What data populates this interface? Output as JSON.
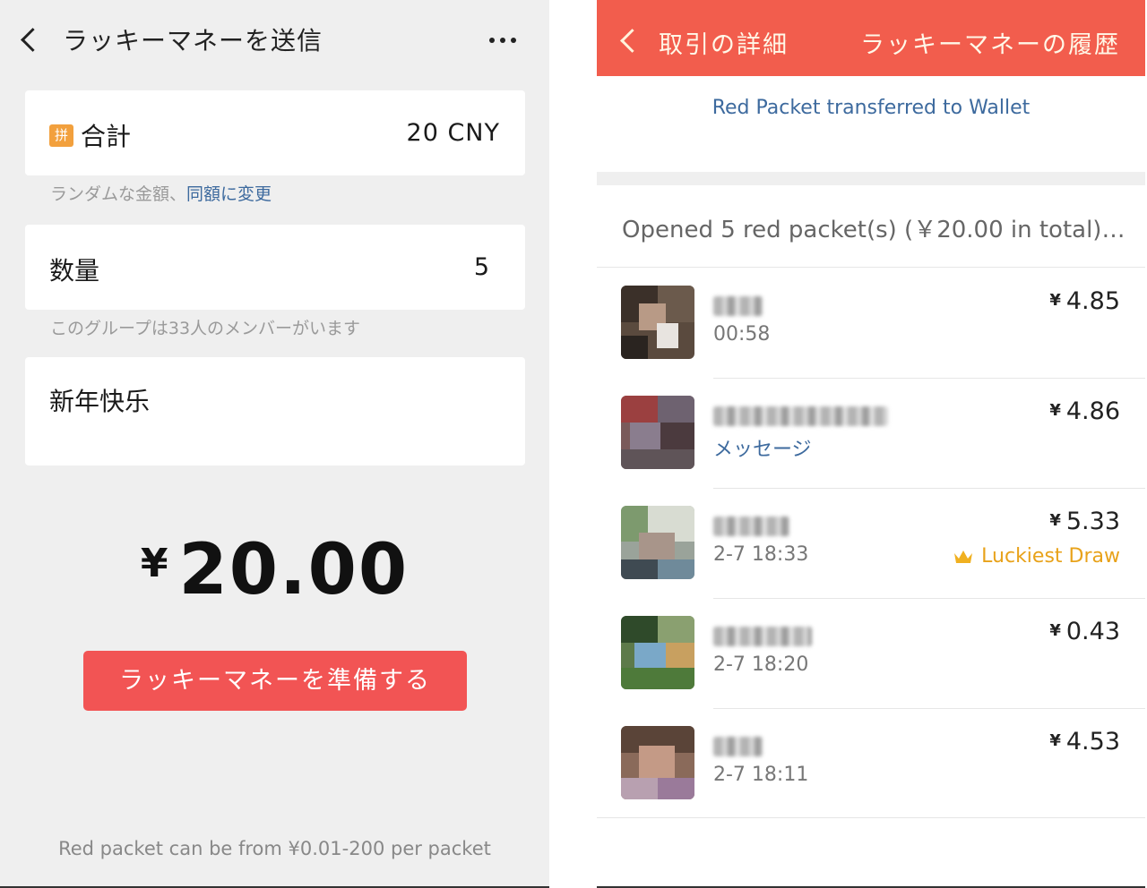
{
  "left": {
    "header": {
      "title": "ラッキーマネーを送信"
    },
    "total": {
      "badge": "拼",
      "label": "合計",
      "value": "20  CNY"
    },
    "amount_hint": {
      "text": "ランダムな金額、",
      "link": "同額に変更"
    },
    "quantity": {
      "label": "数量",
      "value": "5"
    },
    "group_hint": "このグループは33人のメンバーがいます",
    "message": "新年快乐",
    "amount_display": {
      "symbol": "¥",
      "value": "20.00"
    },
    "prepare_button": "ラッキーマネーを準備する",
    "footnote": "Red packet can be from ¥0.01-200 per packet"
  },
  "right": {
    "header": {
      "detail_title": "取引の詳細",
      "history_title": "ラッキーマネーの履歴"
    },
    "wallet_note": "Red Packet transferred to Wallet",
    "summary": "Opened 5 red packet(s) (￥20.00 in total) in...",
    "entries": [
      {
        "sub": "00:58",
        "currency": "¥",
        "amount": "4.85",
        "badge": ""
      },
      {
        "sub": "メッセージ",
        "currency": "¥",
        "amount": "4.86",
        "badge": ""
      },
      {
        "sub": "2-7 18:33",
        "currency": "¥",
        "amount": "5.33",
        "badge": "Luckiest Draw"
      },
      {
        "sub": "2-7 18:20",
        "currency": "¥",
        "amount": "0.43",
        "badge": ""
      },
      {
        "sub": "2-7 18:11",
        "currency": "¥",
        "amount": "4.53",
        "badge": ""
      }
    ]
  },
  "icons": {
    "back": "chevron-left-icon",
    "more": "more-dots-icon",
    "badge": "pin-badge-icon",
    "crown": "crown-icon"
  },
  "colors": {
    "header_red": "#f25d4d",
    "button_red": "#f25454",
    "link_blue": "#3d6a9e",
    "lucky_gold": "#e8a21a",
    "badge_orange": "#f2a03d"
  }
}
